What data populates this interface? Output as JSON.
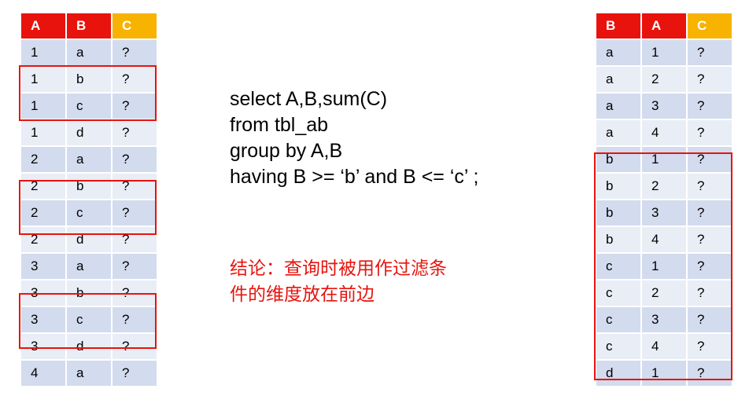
{
  "left_table": {
    "headers": [
      "A",
      "B",
      "C"
    ],
    "rows": [
      [
        "1",
        "a",
        "?"
      ],
      [
        "1",
        "b",
        "?"
      ],
      [
        "1",
        "c",
        "?"
      ],
      [
        "1",
        "d",
        "?"
      ],
      [
        "2",
        "a",
        "?"
      ],
      [
        "2",
        "b",
        "?"
      ],
      [
        "2",
        "c",
        "?"
      ],
      [
        "2",
        "d",
        "?"
      ],
      [
        "3",
        "a",
        "?"
      ],
      [
        "3",
        "b",
        "?"
      ],
      [
        "3",
        "c",
        "?"
      ],
      [
        "3",
        "d",
        "?"
      ],
      [
        "4",
        "a",
        "?"
      ]
    ]
  },
  "right_table": {
    "headers": [
      "B",
      "A",
      "C"
    ],
    "rows": [
      [
        "a",
        "1",
        "?"
      ],
      [
        "a",
        "2",
        "?"
      ],
      [
        "a",
        "3",
        "?"
      ],
      [
        "a",
        "4",
        "?"
      ],
      [
        "b",
        "1",
        "?"
      ],
      [
        "b",
        "2",
        "?"
      ],
      [
        "b",
        "3",
        "?"
      ],
      [
        "b",
        "4",
        "?"
      ],
      [
        "c",
        "1",
        "?"
      ],
      [
        "c",
        "2",
        "?"
      ],
      [
        "c",
        "3",
        "?"
      ],
      [
        "c",
        "4",
        "?"
      ],
      [
        "d",
        "1",
        "?"
      ]
    ]
  },
  "sql": {
    "lines": [
      "select A,B,sum(C)",
      "from tbl_ab",
      "group by A,B",
      "having B >= ‘b’ and B <= ‘c’ ;"
    ]
  },
  "conclusion": {
    "lines": [
      "结论：查询时被用作过滤条",
      "件的维度放在前边"
    ]
  },
  "colors": {
    "header_red": "#e8130d",
    "header_yellow": "#f7b300",
    "row_dark": "#d3dbee",
    "row_light": "#e9edf6",
    "highlight_border": "#e8130d",
    "conclusion_text": "#e8130d"
  }
}
